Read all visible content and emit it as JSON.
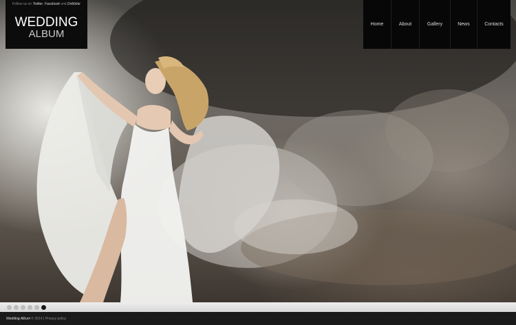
{
  "header": {
    "follow": {
      "prefix": "Follow us on",
      "links": [
        "Twitter",
        "Facebook",
        "Dribbble"
      ],
      "and": "and"
    },
    "logo": {
      "title": "WEDDING",
      "subtitle": "ALBUM"
    }
  },
  "nav": {
    "items": [
      {
        "label": "Home"
      },
      {
        "label": "About"
      },
      {
        "label": "Gallery"
      },
      {
        "label": "News"
      },
      {
        "label": "Contacts"
      }
    ]
  },
  "slider": {
    "slide_count": 6,
    "active_index": 5
  },
  "footer": {
    "brand": "Wedding Album",
    "copyright": "© 2014 |",
    "privacy_link": "Privacy policy"
  },
  "colors": {
    "header_bg": "#0c0c0c",
    "footer_bg": "#1a1a1a",
    "dot_inactive": "#bdbdbd",
    "dot_active": "#1a1a1a"
  }
}
